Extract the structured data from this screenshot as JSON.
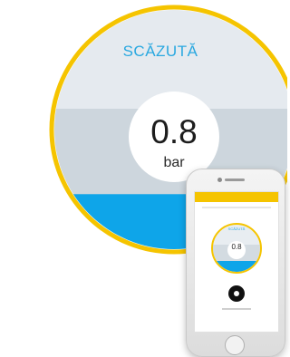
{
  "gauge": {
    "status_label": "SCĂZUTĂ",
    "value": "0.8",
    "unit": "bar",
    "level": 0.23,
    "colors": {
      "ring": "#f5c400",
      "fill": "#0ea5e9",
      "upper": "#e5eaef",
      "middle": "#cdd6dd",
      "status_text": "#29a8e0"
    }
  },
  "phone": {
    "app_status_label": "SCĂZUTĂ",
    "app_value": "0.8",
    "action_icon": "power-button-icon"
  }
}
